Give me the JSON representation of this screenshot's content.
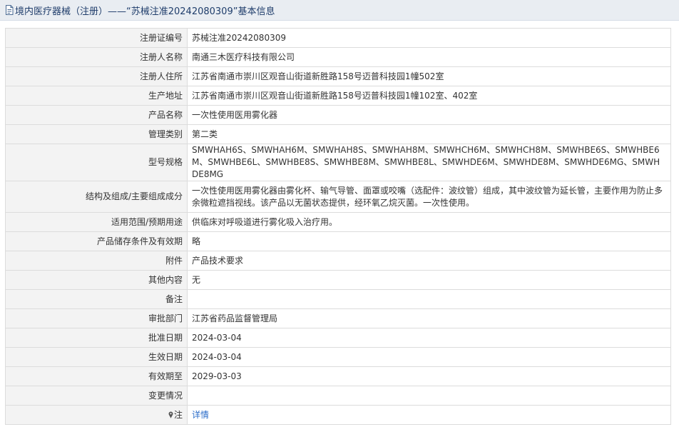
{
  "header": {
    "title": "境内医疗器械（注册）——“苏械注准20242080309”基本信息"
  },
  "rows": [
    {
      "label": "注册证编号",
      "value": "苏械注准20242080309"
    },
    {
      "label": "注册人名称",
      "value": "南通三木医疗科技有限公司"
    },
    {
      "label": "注册人住所",
      "value": "江苏省南通市崇川区观音山街道新胜路158号迈普科技园1幢502室"
    },
    {
      "label": "生产地址",
      "value": "江苏省南通市崇川区观音山街道新胜路158号迈普科技园1幢102室、402室"
    },
    {
      "label": "产品名称",
      "value": "一次性使用医用雾化器"
    },
    {
      "label": "管理类别",
      "value": "第二类"
    },
    {
      "label": "型号规格",
      "value": "SMWHAH6S、SMWHAH6M、SMWHAH8S、SMWHAH8M、SMWHCH6M、SMWHCH8M、SMWHBE6S、SMWHBE6M、SMWHBE6L、SMWHBE8S、SMWHBE8M、SMWHBE8L、SMWHDE6M、SMWHDE8M、SMWHDE6MG、SMWHDE8MG"
    },
    {
      "label": "结构及组成/主要组成成分",
      "value": "一次性使用医用雾化器由雾化杯、输气导管、面罩或咬嘴（选配件：波纹管）组成，其中波纹管为延长管，主要作用为防止多余微粒遮挡视线。该产品以无菌状态提供，经环氧乙烷灭菌。一次性使用。"
    },
    {
      "label": "适用范围/预期用途",
      "value": "供临床对呼吸道进行雾化吸入治疗用。"
    },
    {
      "label": "产品储存条件及有效期",
      "value": "略"
    },
    {
      "label": "附件",
      "value": "产品技术要求"
    },
    {
      "label": "其他内容",
      "value": "无"
    },
    {
      "label": "备注",
      "value": ""
    },
    {
      "label": "审批部门",
      "value": "江苏省药品监督管理局"
    },
    {
      "label": "批准日期",
      "value": "2024-03-04"
    },
    {
      "label": "生效日期",
      "value": "2024-03-04"
    },
    {
      "label": "有效期至",
      "value": "2029-03-03"
    },
    {
      "label": "变更情况",
      "value": ""
    }
  ],
  "note_row": {
    "label": "注",
    "link_text": "详情",
    "icon": "pin-icon"
  },
  "colors": {
    "header_bg": "#e9edf2",
    "header_text": "#1f3d6b",
    "label_bg": "#f3f3f3",
    "border": "#dcdcdc",
    "link": "#2a6cc9"
  }
}
